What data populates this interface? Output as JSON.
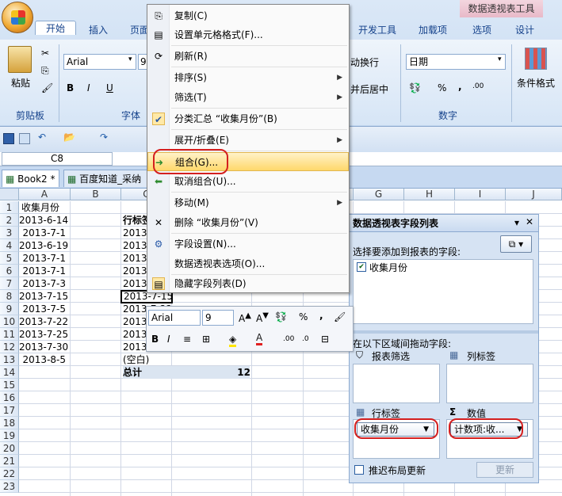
{
  "ribbon": {
    "context_title": "数据透视表工具",
    "tabs": [
      "开始",
      "插入",
      "页面",
      "开发工具",
      "加载项",
      "选项",
      "设计"
    ],
    "paste": "粘贴",
    "clipboard": "剪贴板",
    "font_group": "字体",
    "font_name": "Arial",
    "font_size": "9",
    "bold": "B",
    "italic": "I",
    "underline": "U",
    "wrap": "动换行",
    "merge": "并后居中",
    "number_format": "日期",
    "number_group": "数字",
    "pct": "%",
    "comma": ",",
    "cond": "条件格式"
  },
  "formula": {
    "name_box": "C8"
  },
  "sheet_tabs": [
    "Book2 *",
    "百度知道_采纳"
  ],
  "columns": [
    "A",
    "B",
    "C",
    "D",
    "E",
    "F",
    "G",
    "H",
    "I",
    "J"
  ],
  "rows": [
    "1",
    "2",
    "3",
    "4",
    "5",
    "6",
    "7",
    "8",
    "9",
    "10",
    "11",
    "12",
    "13",
    "14",
    "15",
    "16",
    "17",
    "18",
    "19",
    "20",
    "21",
    "22",
    "23"
  ],
  "colA": [
    "收集月份",
    "2013-6-14",
    "2013-7-1",
    "2013-6-19",
    "2013-7-1",
    "2013-7-1",
    "2013-7-3",
    "2013-7-15",
    "2013-7-5",
    "2013-7-22",
    "2013-7-25",
    "2013-7-30",
    "2013-8-5"
  ],
  "colC": [
    "行标签",
    "2013",
    "2013",
    "2013",
    "2013",
    "2013",
    "2013-7-15",
    "2013-7-22",
    "2013",
    "2013",
    "2013",
    "(空白)",
    "总计"
  ],
  "total_value": "12",
  "menu": {
    "copy": "复制(C)",
    "format_cells": "设置单元格格式(F)...",
    "refresh": "刷新(R)",
    "sort": "排序(S)",
    "filter": "筛选(T)",
    "subtotal": "分类汇总 “收集月份”(B)",
    "expand": "展开/折叠(E)",
    "group": "组合(G)...",
    "ungroup": "取消组合(U)...",
    "move": "移动(M)",
    "delete": "删除 “收集月份”(V)",
    "field_settings": "字段设置(N)...",
    "pivot_options": "数据透视表选项(O)...",
    "hide_field_list": "隐藏字段列表(D)"
  },
  "minitb": {
    "font": "Arial",
    "size": "9"
  },
  "pane": {
    "title": "数据透视表字段列表",
    "choose": "选择要添加到报表的字段:",
    "field": "收集月份",
    "drag": "在以下区域间拖动字段:",
    "report_filter": "报表筛选",
    "col_labels": "列标签",
    "row_labels": "行标签",
    "values": "数值",
    "row_field": "收集月份",
    "value_field": "计数项:收...",
    "defer": "推迟布局更新",
    "update": "更新"
  }
}
